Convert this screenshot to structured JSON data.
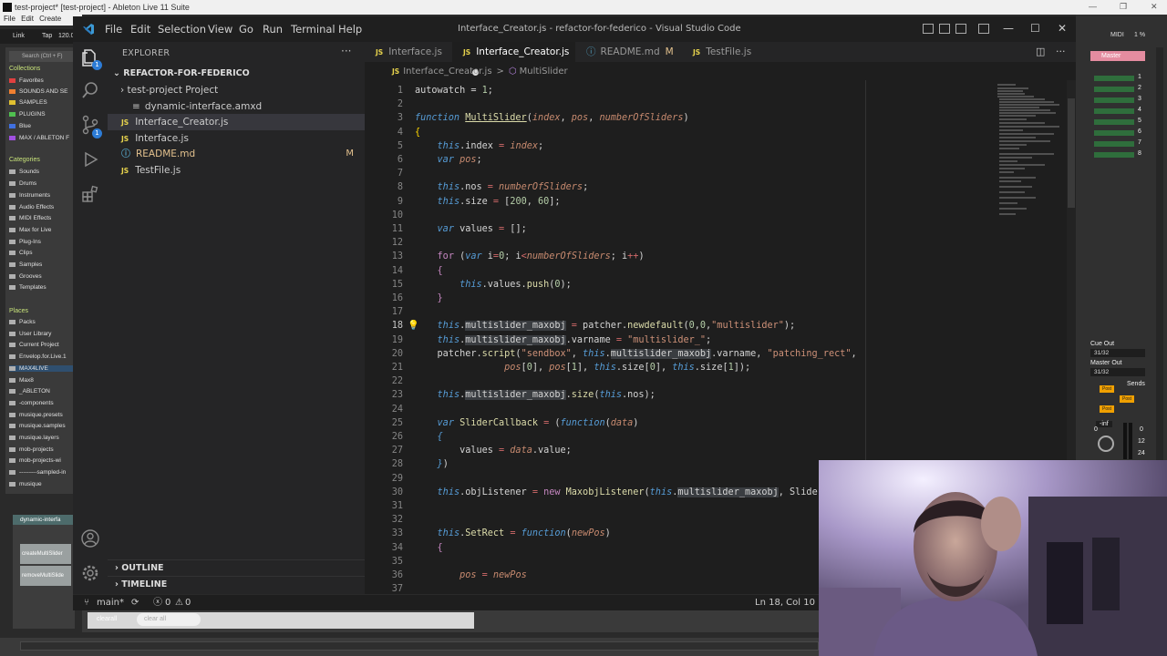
{
  "ableton": {
    "title": "test-project* [test-project] - Ableton Live 11 Suite",
    "menu": [
      "File",
      "Edit",
      "Create"
    ],
    "transport": {
      "link": "Link",
      "tap": "Tap",
      "tempo": "120.0"
    },
    "browser": {
      "search_placeholder": "Search (Ctrl + F)",
      "collections_header": "Collections",
      "collections": [
        "Favorites",
        "SOUNDS AND SE",
        "SAMPLES",
        "PLUGINS",
        "Blue",
        "MAX / ABLETON F"
      ],
      "categories_header": "Categories",
      "categories": [
        "Sounds",
        "Drums",
        "Instruments",
        "Audio Effects",
        "MIDI Effects",
        "Max for Live",
        "Plug-Ins",
        "Clips",
        "Samples",
        "Grooves",
        "Templates"
      ],
      "places_header": "Places",
      "places": [
        "Packs",
        "User Library",
        "Current Project",
        "Envelop.for.Live.1",
        "MAX4LIVE",
        "Max8",
        "_ABLETON",
        "-components",
        "musique.presets",
        "musique.samples",
        "musique.layers",
        "mob-projects",
        "mob-projects-wi",
        "---------sampled-in",
        "musique"
      ]
    },
    "device": {
      "title": "dynamic-interfa",
      "create_button": "createMultiSlider",
      "remove_button": "removeMultiSlide"
    },
    "bottom": {
      "clear_all": "clearall",
      "clear_all_placeholder": "clear all"
    },
    "right_panel": {
      "midi": "MIDI",
      "cpu": "1 %",
      "master": "Master",
      "track_numbers": [
        "1",
        "2",
        "3",
        "4",
        "5",
        "6",
        "7",
        "8"
      ],
      "cue_out_label": "Cue Out",
      "cue_out_value": "31/32",
      "master_out_label": "Master Out",
      "master_out_value": "31/32",
      "sends": "Sends",
      "post": "Post",
      "volume": "-inf",
      "zero": "0",
      "meter_ticks": [
        "0",
        "12",
        "24"
      ]
    }
  },
  "vscode": {
    "menu": [
      "File",
      "Edit",
      "Selection",
      "View",
      "Go",
      "Run",
      "Terminal",
      "Help"
    ],
    "window_title": "Interface_Creator.js - refactor-for-federico - Visual Studio Code",
    "explorer": {
      "title": "EXPLORER",
      "more": "···",
      "folder": "REFACTOR-FOR-FEDERICO",
      "files": [
        {
          "name": "test-project Project",
          "kind": "folder",
          "mod": ""
        },
        {
          "name": "dynamic-interface.amxd",
          "kind": "file",
          "mod": ""
        },
        {
          "name": "Interface_Creator.js",
          "kind": "js",
          "mod": ""
        },
        {
          "name": "Interface.js",
          "kind": "js",
          "mod": ""
        },
        {
          "name": "README.md",
          "kind": "md",
          "mod": "M"
        },
        {
          "name": "TestFile.js",
          "kind": "js",
          "mod": ""
        }
      ],
      "outline": "OUTLINE",
      "timeline": "TIMELINE"
    },
    "activity_badges": {
      "explorer": "1",
      "source_control": "1"
    },
    "tabs": [
      {
        "label": "Interface.js",
        "type": "JS",
        "active": false,
        "modified": ""
      },
      {
        "label": "Interface_Creator.js",
        "type": "JS",
        "active": true,
        "modified": "dirty"
      },
      {
        "label": "README.md",
        "type": "MD",
        "active": false,
        "modified": "M"
      },
      {
        "label": "TestFile.js",
        "type": "JS",
        "active": false,
        "modified": ""
      }
    ],
    "breadcrumb": {
      "file": "Interface_Creator.js",
      "separator": ">",
      "symbol": "MultiSlider"
    },
    "code_lines": [
      "1",
      "2",
      "3",
      "4",
      "5",
      "6",
      "7",
      "8",
      "9",
      "10",
      "11",
      "12",
      "13",
      "14",
      "15",
      "16",
      "17",
      "18",
      "19",
      "20",
      "21",
      "22",
      "23",
      "24",
      "25",
      "26",
      "27",
      "28",
      "29",
      "30",
      "31",
      "32",
      "33",
      "34",
      "35",
      "36",
      "37"
    ],
    "current_line": "18",
    "statusbar": {
      "branch": "main*",
      "sync": "⟳",
      "errors": "0",
      "warnings": "0",
      "cursor": "Ln 18, Col 10 (1"
    },
    "js_icon": "JS",
    "md_icon": "ⓘ"
  }
}
